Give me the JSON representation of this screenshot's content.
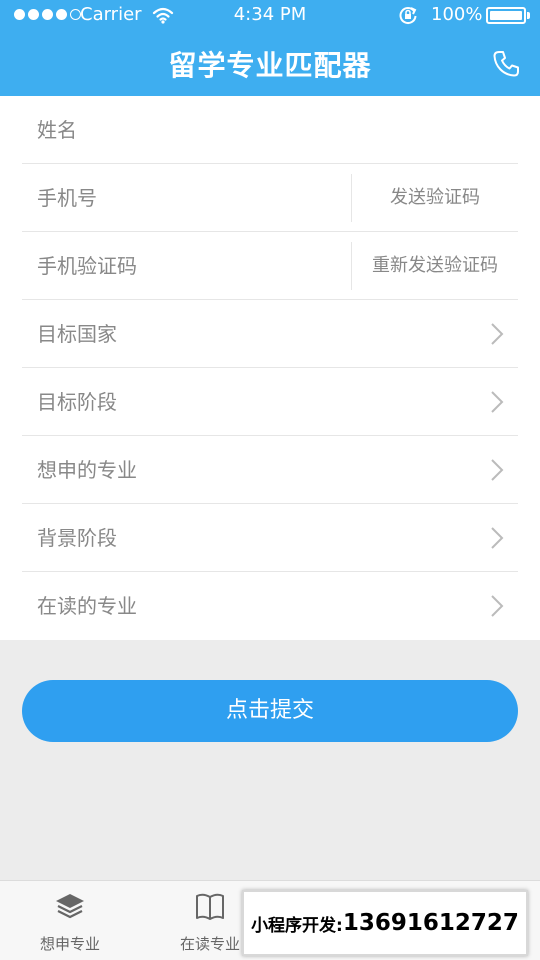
{
  "status_bar": {
    "carrier": "Carrier",
    "time": "4:34 PM",
    "battery": "100%"
  },
  "header": {
    "title": "留学专业匹配器",
    "right_icon": "phone-icon"
  },
  "form": {
    "name_label": "姓名",
    "phone_label": "手机号",
    "send_code": "发送验证码",
    "code_label": "手机验证码",
    "resend_code": "重新发送验证码",
    "country_label": "目标国家",
    "stage_label": "目标阶段",
    "major_label": "想申的专业",
    "background_label": "背景阶段",
    "current_major_label": "在读的专业"
  },
  "submit_label": "点击提交",
  "tabs": [
    {
      "label": "想申专业",
      "icon": "layers-icon"
    },
    {
      "label": "在读专业",
      "icon": "book-icon"
    }
  ],
  "overlay": {
    "label": "小程序开发:",
    "number": "13691612727"
  },
  "colors": {
    "header": "#3eaef0",
    "submit": "#2f9ff0",
    "background": "#ececec"
  }
}
